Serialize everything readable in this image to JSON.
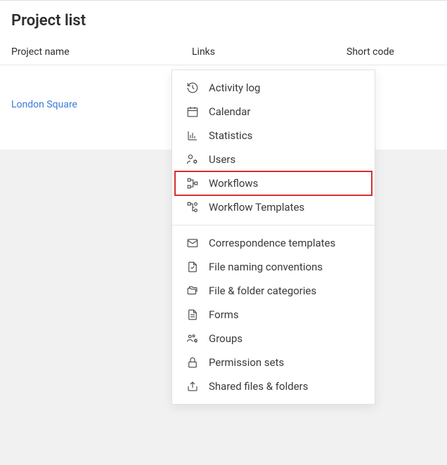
{
  "header": {
    "title": "Project list"
  },
  "columns": {
    "name": "Project name",
    "links": "Links",
    "code": "Short code"
  },
  "row": {
    "project_name": "London Square"
  },
  "menu": {
    "section1": {
      "activity_log": "Activity log",
      "calendar": "Calendar",
      "statistics": "Statistics",
      "users": "Users",
      "workflows": "Workflows",
      "workflow_templates": "Workflow Templates"
    },
    "section2": {
      "correspondence_templates": "Correspondence templates",
      "file_naming": "File naming conventions",
      "file_folder_cats": "File & folder categories",
      "forms": "Forms",
      "groups": "Groups",
      "permission_sets": "Permission sets",
      "shared": "Shared files & folders"
    }
  }
}
